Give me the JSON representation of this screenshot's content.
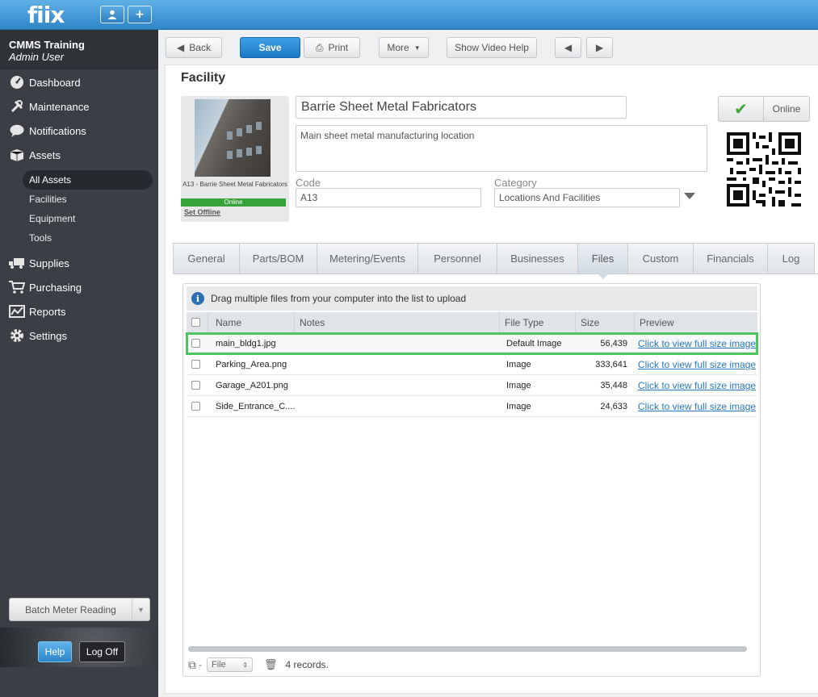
{
  "app": {
    "logo": "fiix"
  },
  "header_buttons": {
    "user": "👤",
    "add": "+"
  },
  "org": {
    "name": "CMMS Training",
    "user": "Admin User"
  },
  "nav": [
    {
      "label": "Dashboard",
      "icon": "dashboard-icon"
    },
    {
      "label": "Maintenance",
      "icon": "wrench-icon"
    },
    {
      "label": "Notifications",
      "icon": "chat-bubble-icon"
    },
    {
      "label": "Assets",
      "icon": "boxes-icon"
    }
  ],
  "assets_sub": [
    "All Assets",
    "Facilities",
    "Equipment",
    "Tools"
  ],
  "nav2": [
    {
      "label": "Supplies",
      "icon": "truck-icon"
    },
    {
      "label": "Purchasing",
      "icon": "cart-icon"
    },
    {
      "label": "Reports",
      "icon": "chart-icon"
    },
    {
      "label": "Settings",
      "icon": "gear-icon"
    }
  ],
  "batch": {
    "label": "Batch Meter Reading"
  },
  "footer": {
    "help": "Help",
    "logoff": "Log Off"
  },
  "toolbar": {
    "back": "Back",
    "save": "Save",
    "print": "Print",
    "more": "More",
    "video": "Show Video Help"
  },
  "page": {
    "title": "Facility"
  },
  "image": {
    "caption": "A13 - Barrie Sheet Metal Fabricators",
    "status": "Online",
    "set_offline": "Set Offline"
  },
  "form": {
    "name": "Barrie Sheet Metal Fabricators",
    "description": "Main sheet metal manufacturing location",
    "code_label": "Code",
    "code": "A13",
    "category_label": "Category",
    "category": "Locations And Facilities",
    "status": "Online"
  },
  "tabs": [
    "General",
    "Parts/BOM",
    "Metering/Events",
    "Personnel",
    "Businesses",
    "Files",
    "Custom",
    "Financials",
    "Log"
  ],
  "active_tab": "Files",
  "files": {
    "hint": "Drag multiple files from your computer into the list to upload",
    "columns": [
      "Name",
      "Notes",
      "File Type",
      "Size",
      "Preview"
    ],
    "rows": [
      {
        "name": "main_bldg1.jpg",
        "notes": "",
        "type": "Default Image",
        "size": "56,439",
        "preview": "Click to view full size image"
      },
      {
        "name": "Parking_Area.png",
        "notes": "",
        "type": "Image",
        "size": "333,641",
        "preview": "Click to view full size image"
      },
      {
        "name": "Garage_A201.png",
        "notes": "",
        "type": "Image",
        "size": "35,448",
        "preview": "Click to view full size image"
      },
      {
        "name": "Side_Entrance_C....",
        "notes": "",
        "type": "Image",
        "size": "24,633",
        "preview": "Click to view full size image"
      }
    ],
    "filter": "File",
    "records": "4 records."
  },
  "colors": {
    "accent": "#2f86c8",
    "online": "#38a23a",
    "selection": "#4cc55a"
  }
}
